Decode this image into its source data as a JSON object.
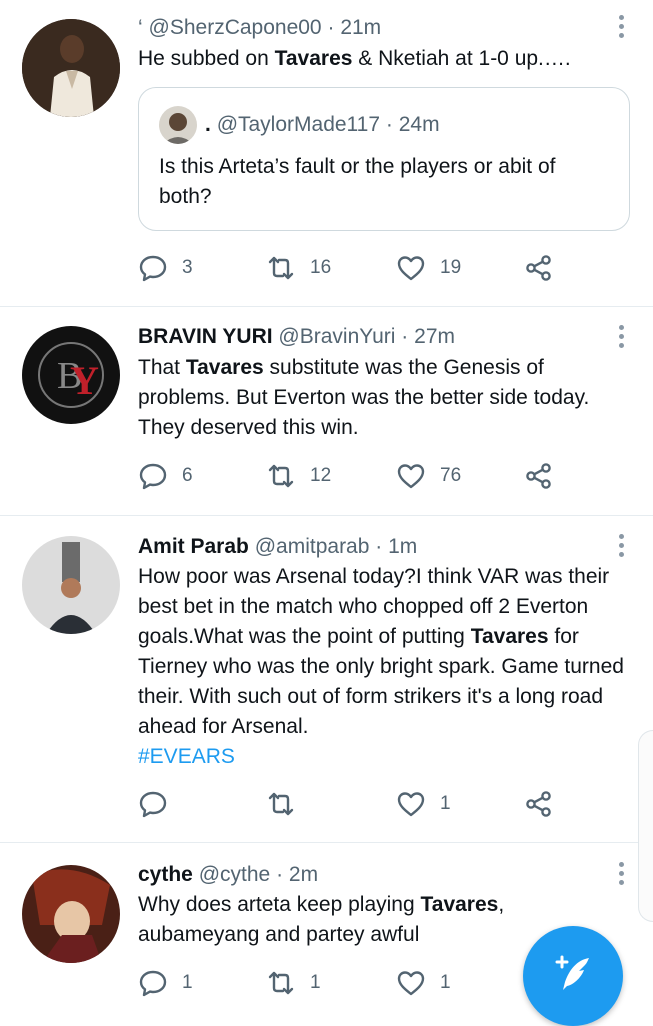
{
  "colors": {
    "accent": "#1d9bf0",
    "secondary_text": "#536471",
    "divider": "#e6ecf0"
  },
  "tweets": [
    {
      "name": "",
      "prefix": "‘",
      "handle": "@SherzCapone00",
      "dot": "·",
      "time": "21m",
      "body": [
        {
          "t": "He subbed on ",
          "b": false
        },
        {
          "t": "Tavares",
          "b": true
        },
        {
          "t": " & Nketiah at 1-0 up.….",
          "b": false
        }
      ],
      "quote": {
        "prefix": ".",
        "handle": "@TaylorMade117",
        "dot": "·",
        "time": "24m",
        "text": "Is this Arteta’s fault or the players or abit of both?"
      },
      "replies": "3",
      "retweets": "16",
      "likes": "19"
    },
    {
      "name": "BRAVIN YURI",
      "handle": "@BravinYuri",
      "dot": "·",
      "time": "27m",
      "body": [
        {
          "t": "That ",
          "b": false
        },
        {
          "t": "Tavares",
          "b": true
        },
        {
          "t": " substitute was the Genesis of problems. But Everton was the better side today. They deserved this win.",
          "b": false
        }
      ],
      "replies": "6",
      "retweets": "12",
      "likes": "76"
    },
    {
      "name": "Amit Parab",
      "handle": "@amitparab",
      "dot": "·",
      "time": "1m",
      "body": [
        {
          "t": "How poor was Arsenal today?I think VAR was their best bet in the match who chopped off 2 Everton goals.What was the point of putting ",
          "b": false
        },
        {
          "t": "Tavares",
          "b": true
        },
        {
          "t": " for Tierney who was the only bright spark. Game turned their. With such out of form strikers it's a long road ahead for Arsenal.",
          "b": false
        }
      ],
      "hashtag": "#EVEARS",
      "replies": "",
      "retweets": "",
      "likes": "1"
    },
    {
      "name": "cythe",
      "handle": "@cythe",
      "dot": "·",
      "time": "2m",
      "body": [
        {
          "t": "Why does arteta keep playing ",
          "b": false
        },
        {
          "t": "Tavares",
          "b": true
        },
        {
          "t": ",",
          "b": false
        },
        {
          "t": " aubameyang and partey awful",
          "b": false
        }
      ],
      "replies": "1",
      "retweets": "1",
      "likes": "1"
    }
  ],
  "icons": {
    "reply": "reply-icon",
    "retweet": "retweet-icon",
    "like": "heart-icon",
    "share": "share-icon",
    "more": "more-vertical-icon",
    "compose": "compose-tweet-icon"
  }
}
